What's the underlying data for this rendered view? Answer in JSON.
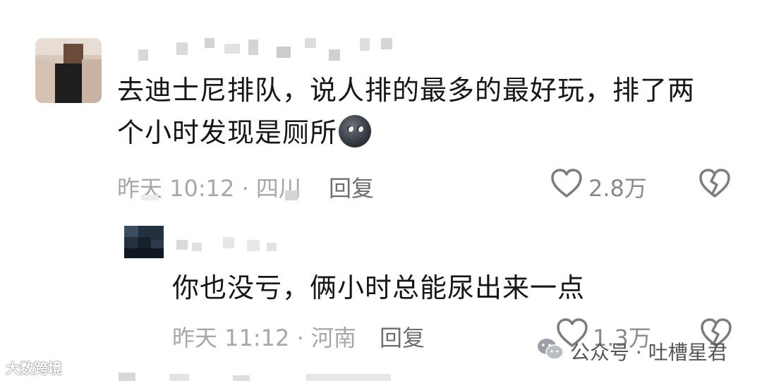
{
  "comments": [
    {
      "text_line1": "去迪士尼排队，说人排的最多的最好玩，排了两",
      "text_line2": "个小时发现是厕所",
      "emoji": "new-moon-face",
      "meta": "昨天 10:12 · 四川",
      "reply_label": "回复",
      "like_count": "2.8万"
    },
    {
      "text": "你也没亏，俩小时总能尿出来一点",
      "meta": "昨天 11:12 · 河南",
      "reply_label": "回复",
      "like_count": "1.3万"
    }
  ],
  "watermarks": {
    "left": "大数跨境",
    "right": "公众号 · 吐槽星君"
  },
  "icons": {
    "like": "heart-outline-icon",
    "dislike": "broken-heart-icon",
    "wechat": "wechat-logo-icon"
  },
  "colors": {
    "text": "#161616",
    "meta": "#a7a7a7",
    "icon": "#7c7c7c"
  }
}
